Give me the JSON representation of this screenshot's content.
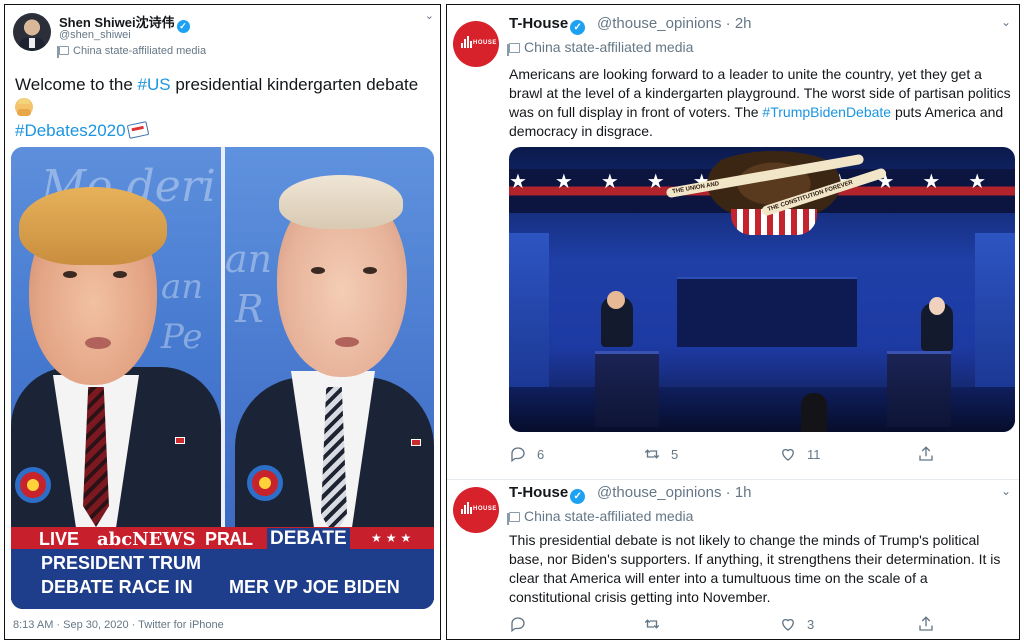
{
  "left_tweet": {
    "author_name": "Shen Shiwei沈诗伟",
    "handle": "@shen_shiwei",
    "affiliation": "China state-affiliated media",
    "text_parts": [
      "Welcome to the ",
      "#US",
      " presidential kindergarten debate"
    ],
    "hashtag2": "#Debates2020",
    "image": {
      "lower_third": {
        "live": "LIVE",
        "network": "abcNEWS",
        "pr": "PR",
        "al": "AL",
        "debate": "DEBATE",
        "line1_left": "PRESIDENT TRUM",
        "line2_left": "DEBATE RACE IN",
        "line2_right": "MER VP JOE BIDEN"
      }
    },
    "meta": "8:13 AM · Sep 30, 2020 · Twitter for iPhone"
  },
  "right_tweets": [
    {
      "author_name": "T-House",
      "handle": "@thouse_opinions",
      "time": "· 2h",
      "affiliation": "China state-affiliated media",
      "text_before": "Americans are looking forward to a leader to unite the country, yet they get a brawl at the level of a kindergarten playground. The worst side of partisan politics was on full display in front of voters. The ",
      "hashtag": "#TrumpBidenDebate",
      "text_after": " puts America and democracy in disgrace.",
      "photo": {
        "banner_top": "THE UNION AND",
        "banner_bottom": "THE CONSTITUTION FOREVER"
      },
      "actions": {
        "replies": "6",
        "retweets": "5",
        "likes": "11"
      }
    },
    {
      "author_name": "T-House",
      "handle": "@thouse_opinions",
      "time": "· 1h",
      "affiliation": "China state-affiliated media",
      "text": "This presidential debate is not likely to change the minds of Trump's political base, nor Biden's supporters. If anything, it strengthens their determination. It is clear that America will enter into a tumultuous time on the scale of a constitutional crisis getting into November.",
      "actions": {
        "replies": "",
        "retweets": "",
        "likes": "3"
      }
    }
  ],
  "logo_word": "HOUSE",
  "icons": [
    "verified-badge-icon",
    "state-media-flag-icon",
    "chevron-down-icon",
    "reply-icon",
    "retweet-icon",
    "like-icon",
    "share-icon"
  ],
  "colors": {
    "link": "#1b95e0",
    "verified": "#1da1f2",
    "muted": "#657786",
    "t_house_red": "#d7212b"
  }
}
